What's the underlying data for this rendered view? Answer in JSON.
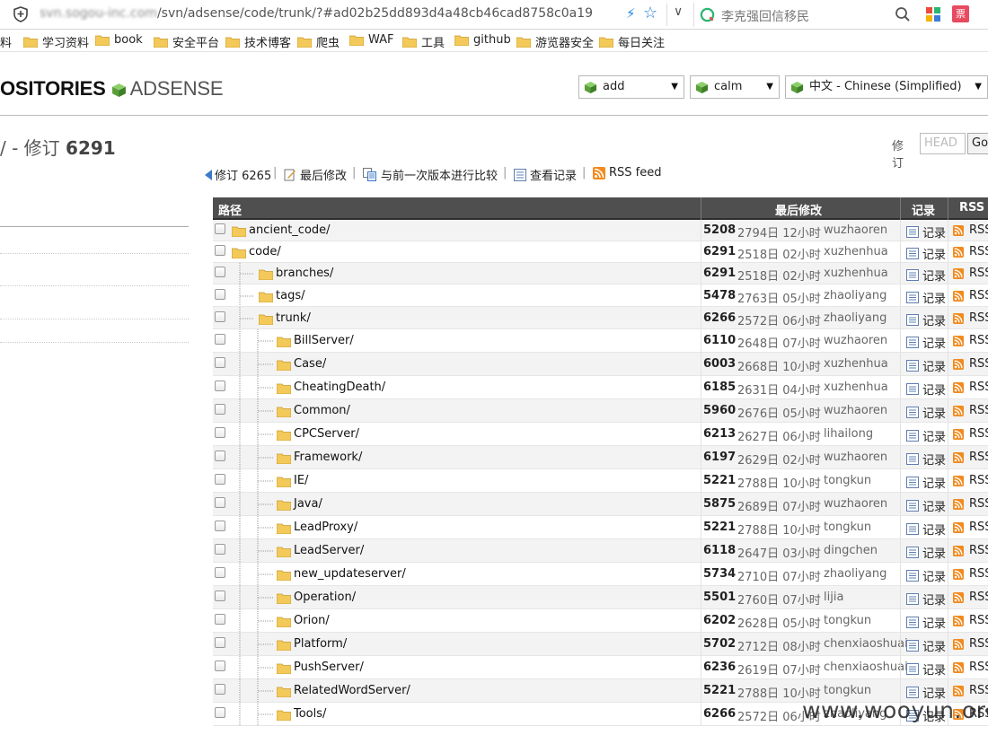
{
  "browser": {
    "url_host": "svn.sogou-inc.com",
    "url_path": "/svn/adsense/code/trunk/?#ad02b25dd893d4a48cb46cad8758c0a19",
    "search_text": "李克强回信移民",
    "ext_badge": "票"
  },
  "bookmarks": [
    {
      "label": "料",
      "folder": false
    },
    {
      "label": "学习资料",
      "folder": true
    },
    {
      "label": "book",
      "folder": true
    },
    {
      "label": "安全平台",
      "folder": true
    },
    {
      "label": "技术博客",
      "folder": true
    },
    {
      "label": "爬虫",
      "folder": true
    },
    {
      "label": "WAF",
      "folder": true
    },
    {
      "label": "工具",
      "folder": true
    },
    {
      "label": "github",
      "folder": true
    },
    {
      "label": "游览器安全",
      "folder": true
    },
    {
      "label": "每日关注",
      "folder": true
    }
  ],
  "header": {
    "repos": "OSITORIES",
    "project": "ADSENSE",
    "select_action": "add",
    "select_theme": "calm",
    "select_lang": "中文 - Chinese (Simplified)"
  },
  "revision": {
    "prefix": "/ - 修订",
    "number": "6291",
    "form_label": "修订",
    "form_placeholder": "HEAD",
    "go_label": "Go"
  },
  "actions": {
    "rev": "修订 6265",
    "last_modified": "最后修改",
    "compare": "与前一次版本进行比较",
    "view_log": "查看记录",
    "rss": "RSS feed"
  },
  "table": {
    "col_path": "路径",
    "col_last_modified": "最后修改",
    "col_log": "记录",
    "col_rss": "RSS",
    "log_label": "记录",
    "rss_label": "RSS",
    "rows": [
      {
        "name": "ancient_code/",
        "depth": 0,
        "rev": "5208",
        "age": "2794日 12小时",
        "author": "wuzhaoren"
      },
      {
        "name": "code/",
        "depth": 0,
        "rev": "6291",
        "age": "2518日 02小时",
        "author": "xuzhenhua"
      },
      {
        "name": "branches/",
        "depth": 1,
        "rev": "6291",
        "age": "2518日 02小时",
        "author": "xuzhenhua"
      },
      {
        "name": "tags/",
        "depth": 1,
        "rev": "5478",
        "age": "2763日 05小时",
        "author": "zhaoliyang"
      },
      {
        "name": "trunk/",
        "depth": 1,
        "rev": "6266",
        "age": "2572日 06小时",
        "author": "zhaoliyang"
      },
      {
        "name": "BillServer/",
        "depth": 2,
        "rev": "6110",
        "age": "2648日 07小时",
        "author": "wuzhaoren"
      },
      {
        "name": "Case/",
        "depth": 2,
        "rev": "6003",
        "age": "2668日 10小时",
        "author": "xuzhenhua"
      },
      {
        "name": "CheatingDeath/",
        "depth": 2,
        "rev": "6185",
        "age": "2631日 04小时",
        "author": "xuzhenhua"
      },
      {
        "name": "Common/",
        "depth": 2,
        "rev": "5960",
        "age": "2676日 05小时",
        "author": "wuzhaoren"
      },
      {
        "name": "CPCServer/",
        "depth": 2,
        "rev": "6213",
        "age": "2627日 06小时",
        "author": "lihailong"
      },
      {
        "name": "Framework/",
        "depth": 2,
        "rev": "6197",
        "age": "2629日 02小时",
        "author": "wuzhaoren"
      },
      {
        "name": "IE/",
        "depth": 2,
        "rev": "5221",
        "age": "2788日 10小时",
        "author": "tongkun"
      },
      {
        "name": "Java/",
        "depth": 2,
        "rev": "5875",
        "age": "2689日 07小时",
        "author": "wuzhaoren"
      },
      {
        "name": "LeadProxy/",
        "depth": 2,
        "rev": "5221",
        "age": "2788日 10小时",
        "author": "tongkun"
      },
      {
        "name": "LeadServer/",
        "depth": 2,
        "rev": "6118",
        "age": "2647日 03小时",
        "author": "dingchen"
      },
      {
        "name": "new_updateserver/",
        "depth": 2,
        "rev": "5734",
        "age": "2710日 07小时",
        "author": "zhaoliyang"
      },
      {
        "name": "Operation/",
        "depth": 2,
        "rev": "5501",
        "age": "2760日 07小时",
        "author": "lijia"
      },
      {
        "name": "Orion/",
        "depth": 2,
        "rev": "6202",
        "age": "2628日 05小时",
        "author": "tongkun"
      },
      {
        "name": "Platform/",
        "depth": 2,
        "rev": "5702",
        "age": "2712日 08小时",
        "author": "chenxiaoshuai"
      },
      {
        "name": "PushServer/",
        "depth": 2,
        "rev": "6236",
        "age": "2619日 07小时",
        "author": "chenxiaoshuai"
      },
      {
        "name": "RelatedWordServer/",
        "depth": 2,
        "rev": "5221",
        "age": "2788日 10小时",
        "author": "tongkun"
      },
      {
        "name": "Tools/",
        "depth": 2,
        "rev": "6266",
        "age": "2572日 06小时",
        "author": "zhaoliyang"
      }
    ]
  },
  "watermark": "www.wooyun.org",
  "colors": {
    "header_bg": "#4f4f4f",
    "row_alt": "#f3f3f3",
    "folder_fill": "#f3c95a",
    "cube_green": "#6aa84f",
    "rss_orange": "#f28a1e"
  }
}
